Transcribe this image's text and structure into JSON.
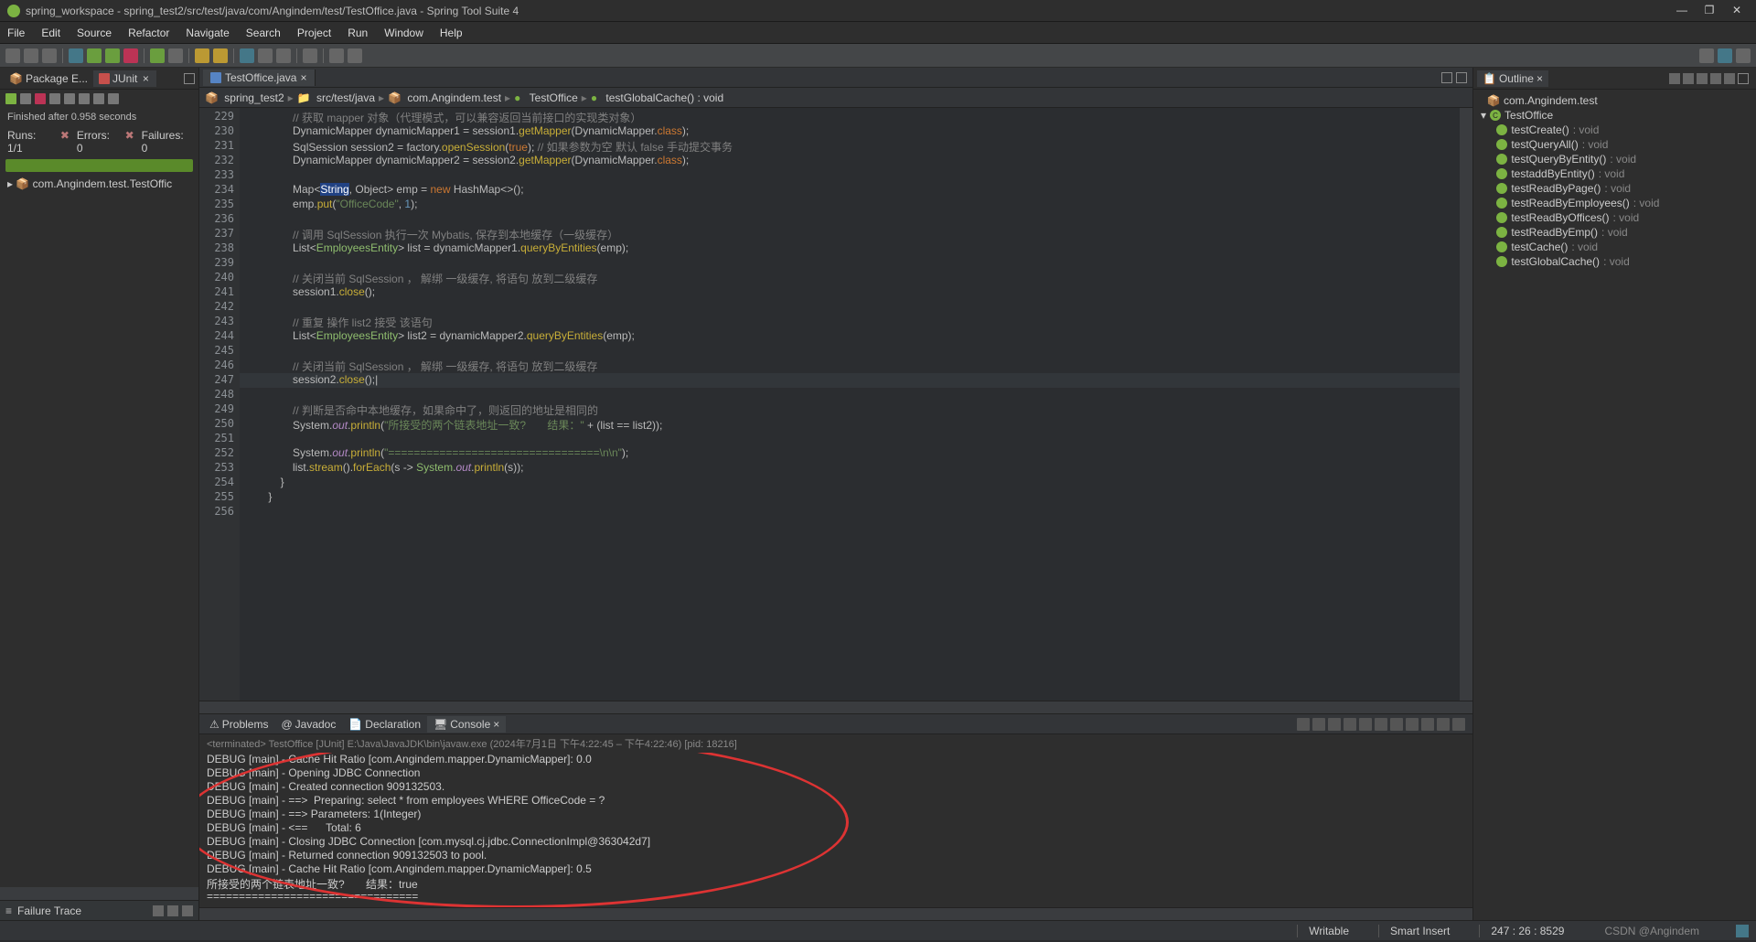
{
  "title": "spring_workspace - spring_test2/src/test/java/com/Angindem/test/TestOffice.java - Spring Tool Suite 4",
  "menu": [
    "File",
    "Edit",
    "Source",
    "Refactor",
    "Navigate",
    "Search",
    "Project",
    "Run",
    "Window",
    "Help"
  ],
  "left_tabs": {
    "pkg": "Package E...",
    "junit": "JUnit"
  },
  "junit": {
    "status": "Finished after 0.958 seconds",
    "runs": "Runs: 1/1",
    "errors": "Errors: 0",
    "failures": "Failures: 0",
    "tree_item": "com.Angindem.test.TestOffic"
  },
  "failure_trace": "Failure Trace",
  "editor_tab": "TestOffice.java",
  "breadcrumb": [
    "spring_test2",
    "src/test/java",
    "com.Angindem.test",
    "TestOffice",
    "testGlobalCache() : void"
  ],
  "code_start_line": 229,
  "code_lines": [
    {
      "t": "// 获取 mapper 对象（代理模式，可以兼容返回当前接口的实现类对象）",
      "ind": 3,
      "cls": "c"
    },
    {
      "raw": [
        [
          "DynamicMapper dynamicMapper1 ",
          "w"
        ],
        [
          "= ",
          "w"
        ],
        [
          "session1",
          "w"
        ],
        [
          ".",
          "w"
        ],
        [
          "getMapper",
          "m"
        ],
        [
          "(",
          "w"
        ],
        [
          "DynamicMapper",
          "w"
        ],
        [
          ".",
          "w"
        ],
        [
          "class",
          "p"
        ],
        [
          ");",
          "w"
        ]
      ],
      "ind": 3
    },
    {
      "raw": [
        [
          "SqlSession session2 ",
          "w"
        ],
        [
          "= ",
          "w"
        ],
        [
          "factory",
          "w"
        ],
        [
          ".",
          "w"
        ],
        [
          "openSession",
          "m"
        ],
        [
          "(",
          "w"
        ],
        [
          "true",
          "k"
        ],
        [
          "); ",
          "w"
        ],
        [
          "// 如果参数为空 默认 false 手动提交事务",
          "c"
        ]
      ],
      "ind": 3
    },
    {
      "raw": [
        [
          "DynamicMapper dynamicMapper2 ",
          "w"
        ],
        [
          "= ",
          "w"
        ],
        [
          "session2",
          "w"
        ],
        [
          ".",
          "w"
        ],
        [
          "getMapper",
          "m"
        ],
        [
          "(",
          "w"
        ],
        [
          "DynamicMapper",
          "w"
        ],
        [
          ".",
          "w"
        ],
        [
          "class",
          "p"
        ],
        [
          ");",
          "w"
        ]
      ],
      "ind": 3
    },
    {
      "t": "",
      "ind": 3
    },
    {
      "raw": [
        [
          "Map",
          "w"
        ],
        [
          "<",
          "w"
        ],
        [
          "String",
          "sel"
        ],
        [
          ", ",
          "w"
        ],
        [
          "Object",
          "w"
        ],
        [
          "> emp ",
          "w"
        ],
        [
          "= ",
          "w"
        ],
        [
          "new ",
          "k"
        ],
        [
          "HashMap",
          "w"
        ],
        [
          "<>();",
          "w"
        ]
      ],
      "ind": 3
    },
    {
      "raw": [
        [
          "emp",
          "w"
        ],
        [
          ".",
          "w"
        ],
        [
          "put",
          "m"
        ],
        [
          "(",
          "w"
        ],
        [
          "\"OfficeCode\"",
          "s"
        ],
        [
          ", ",
          "w"
        ],
        [
          "1",
          "n"
        ],
        [
          ");",
          "w"
        ]
      ],
      "ind": 3
    },
    {
      "t": "",
      "ind": 3
    },
    {
      "t": "// 调用 SqlSession 执行一次 Mybatis, 保存到本地缓存（一级缓存）",
      "ind": 3,
      "cls": "c"
    },
    {
      "raw": [
        [
          "List",
          "w"
        ],
        [
          "<",
          "w"
        ],
        [
          "EmployeesEntity",
          "t"
        ],
        [
          "> list ",
          "w"
        ],
        [
          "= ",
          "w"
        ],
        [
          "dynamicMapper1",
          "w"
        ],
        [
          ".",
          "w"
        ],
        [
          "queryByEntities",
          "m"
        ],
        [
          "(emp);",
          "w"
        ]
      ],
      "ind": 3
    },
    {
      "t": "",
      "ind": 3
    },
    {
      "t": "// 关闭当前 SqlSession ， 解绑 一级缓存, 将语句 放到二级缓存",
      "ind": 3,
      "cls": "c"
    },
    {
      "raw": [
        [
          "session1",
          "w"
        ],
        [
          ".",
          "w"
        ],
        [
          "close",
          "m"
        ],
        [
          "();",
          "w"
        ]
      ],
      "ind": 3
    },
    {
      "t": "",
      "ind": 3
    },
    {
      "t": "// 重复 操作 list2 接受 该语句",
      "ind": 3,
      "cls": "c"
    },
    {
      "raw": [
        [
          "List",
          "w"
        ],
        [
          "<",
          "w"
        ],
        [
          "EmployeesEntity",
          "t"
        ],
        [
          "> list2 ",
          "w"
        ],
        [
          "= ",
          "w"
        ],
        [
          "dynamicMapper2",
          "w"
        ],
        [
          ".",
          "w"
        ],
        [
          "queryByEntities",
          "m"
        ],
        [
          "(emp);",
          "w"
        ]
      ],
      "ind": 3
    },
    {
      "t": "",
      "ind": 3
    },
    {
      "t": "// 关闭当前 SqlSession ， 解绑 一级缓存, 将语句 放到二级缓存",
      "ind": 3,
      "cls": "c"
    },
    {
      "raw": [
        [
          "session2",
          "w"
        ],
        [
          ".",
          "w"
        ],
        [
          "close",
          "m"
        ],
        [
          "();|",
          "w"
        ]
      ],
      "ind": 3,
      "hl": true
    },
    {
      "t": "",
      "ind": 3
    },
    {
      "t": "// 判断是否命中本地缓存，如果命中了，则返回的地址是相同的",
      "ind": 3,
      "cls": "c"
    },
    {
      "raw": [
        [
          "System",
          "w"
        ],
        [
          ".",
          "w"
        ],
        [
          "out",
          "i"
        ],
        [
          ".",
          "w"
        ],
        [
          "println",
          "m"
        ],
        [
          "(",
          "w"
        ],
        [
          "\"所接受的两个链表地址一致?       结果：\"",
          "s"
        ],
        [
          " + (list == list2));",
          "w"
        ]
      ],
      "ind": 3
    },
    {
      "t": "",
      "ind": 3
    },
    {
      "raw": [
        [
          "System",
          "w"
        ],
        [
          ".",
          "w"
        ],
        [
          "out",
          "i"
        ],
        [
          ".",
          "w"
        ],
        [
          "println",
          "m"
        ],
        [
          "(",
          "w"
        ],
        [
          "\"=================================\\n\\n\"",
          "s"
        ],
        [
          ");",
          "w"
        ]
      ],
      "ind": 3
    },
    {
      "raw": [
        [
          "list",
          "w"
        ],
        [
          ".",
          "w"
        ],
        [
          "stream",
          "m"
        ],
        [
          "().",
          "w"
        ],
        [
          "forEach",
          "m"
        ],
        [
          "(s -> ",
          "w"
        ],
        [
          "System",
          "t"
        ],
        [
          ".",
          "w"
        ],
        [
          "out",
          "i"
        ],
        [
          ".",
          "w"
        ],
        [
          "println",
          "m"
        ],
        [
          "(s));",
          "w"
        ]
      ],
      "ind": 3
    },
    {
      "t": "}",
      "ind": 2
    },
    {
      "t": "}",
      "ind": 1
    },
    {
      "t": "",
      "ind": 0
    }
  ],
  "bottom_tabs": [
    "Problems",
    "Javadoc",
    "Declaration",
    "Console"
  ],
  "console_header": "<terminated> TestOffice [JUnit] E:\\Java\\JavaJDK\\bin\\javaw.exe (2024年7月1日 下午4:22:45 – 下午4:22:46) [pid: 18216]",
  "console_lines": [
    "DEBUG [main] - Cache Hit Ratio [com.Angindem.mapper.DynamicMapper]: 0.0",
    "DEBUG [main] - Opening JDBC Connection",
    "DEBUG [main] - Created connection 909132503.",
    "DEBUG [main] - ==>  Preparing: select * from employees WHERE OfficeCode = ?",
    "DEBUG [main] - ==> Parameters: 1(Integer)",
    "DEBUG [main] - <==      Total: 6",
    "DEBUG [main] - Closing JDBC Connection [com.mysql.cj.jdbc.ConnectionImpl@363042d7]",
    "DEBUG [main] - Returned connection 909132503 to pool.",
    "DEBUG [main] - Cache Hit Ratio [com.Angindem.mapper.DynamicMapper]: 0.5",
    "所接受的两个链表地址一致?       结果：true",
    "================================="
  ],
  "outline": {
    "pkg": "com.Angindem.test",
    "class": "TestOffice",
    "methods": [
      "testCreate() : void",
      "testQueryAll() : void",
      "testQueryByEntity() : void",
      "testaddByEntity() : void",
      "testReadByPage() : void",
      "testReadByEmployees() : void",
      "testReadByOffices() : void",
      "testReadByEmp() : void",
      "testCache() : void",
      "testGlobalCache() : void"
    ]
  },
  "outline_title": "Outline",
  "status": {
    "writable": "Writable",
    "insert": "Smart Insert",
    "pos": "247 : 26 : 8529",
    "credit": "CSDN @Angindem"
  }
}
